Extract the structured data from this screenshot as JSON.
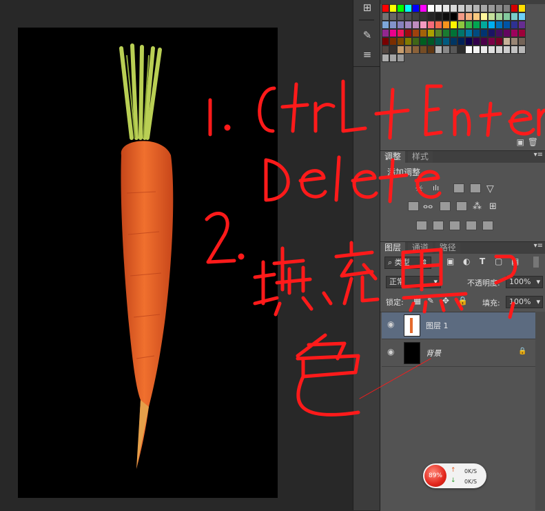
{
  "toolstrip": {
    "icons": [
      "swatches-icon",
      "brush-icon",
      "adjust-sliders-icon"
    ]
  },
  "swatches": {
    "colors": [
      "#ff0000",
      "#ffff00",
      "#00ff00",
      "#00ffff",
      "#0000ff",
      "#ff00ff",
      "#ffffff",
      "#f2f2f2",
      "#e6e6e6",
      "#d9d9d9",
      "#cccccc",
      "#bfbfbf",
      "#b3b3b3",
      "#a6a6a6",
      "#999999",
      "#8c8c8c",
      "#808080",
      "#d60000",
      "#ffde00",
      "#737373",
      "#666666",
      "#595959",
      "#4d4d4d",
      "#404040",
      "#333333",
      "#262626",
      "#1a1a1a",
      "#0d0d0d",
      "#000000",
      "#f39a86",
      "#f5b080",
      "#f9c97f",
      "#fff79c",
      "#c4df9b",
      "#a3d39c",
      "#82ca9d",
      "#7accc8",
      "#6dcff6",
      "#7da7d9",
      "#8393ca",
      "#8781bd",
      "#a187be",
      "#bd8cbf",
      "#f49ac1",
      "#f56b7a",
      "#f26c4f",
      "#f7941d",
      "#fff200",
      "#8dc63f",
      "#39b54a",
      "#00a651",
      "#00a99d",
      "#00aeef",
      "#0072bc",
      "#0054a6",
      "#2e3192",
      "#662d91",
      "#92278f",
      "#ec008c",
      "#ed145b",
      "#9e0b0f",
      "#a0410d",
      "#a36209",
      "#aba000",
      "#598527",
      "#1a7b30",
      "#007236",
      "#00746b",
      "#0076a3",
      "#004b80",
      "#003471",
      "#1b1464",
      "#440e62",
      "#630460",
      "#9e005d",
      "#9e0039",
      "#790000",
      "#7b2e00",
      "#7d4900",
      "#827b00",
      "#406618",
      "#005e20",
      "#005826",
      "#005952",
      "#005b7f",
      "#003663",
      "#002157",
      "#0d004c",
      "#32004b",
      "#4b0049",
      "#7b0046",
      "#7a0026",
      "#c7b299",
      "#998675",
      "#736357",
      "#534741",
      "#37302d",
      "#c69c6d",
      "#a67c52",
      "#8c6239",
      "#754c24",
      "#603813",
      "#b3b3b3",
      "#898989",
      "#585858",
      "#2c2c2c",
      "#fdfdfd",
      "#f4f4f4",
      "#ebebeb",
      "#e0e0e0",
      "#d6d6d6",
      "#cdcdcd",
      "#c2c2c2",
      "#b8b8b8",
      "#aeaeae",
      "#a4a4a4",
      "#9a9a9a"
    ]
  },
  "adjustments": {
    "tabs": [
      "调整",
      "样式"
    ],
    "add_label": "添加调整"
  },
  "layers": {
    "tabs": [
      "图层",
      "通道",
      "路径"
    ],
    "filter": "类型",
    "blend_mode": "正常",
    "opacity_label": "不透明度:",
    "opacity_value": "100%",
    "lock_label": "锁定:",
    "fill_label": "填充:",
    "fill_value": "100%",
    "rows": [
      {
        "name": "图层 1"
      },
      {
        "name": "背景"
      }
    ]
  },
  "speed_widget": {
    "percent": "89%",
    "up": "0K/S",
    "down": "0K/S"
  },
  "annotations": {
    "line1": "1. Ctrl+Enter",
    "line1b": "Delete",
    "line2": "2. 填充黑色"
  }
}
